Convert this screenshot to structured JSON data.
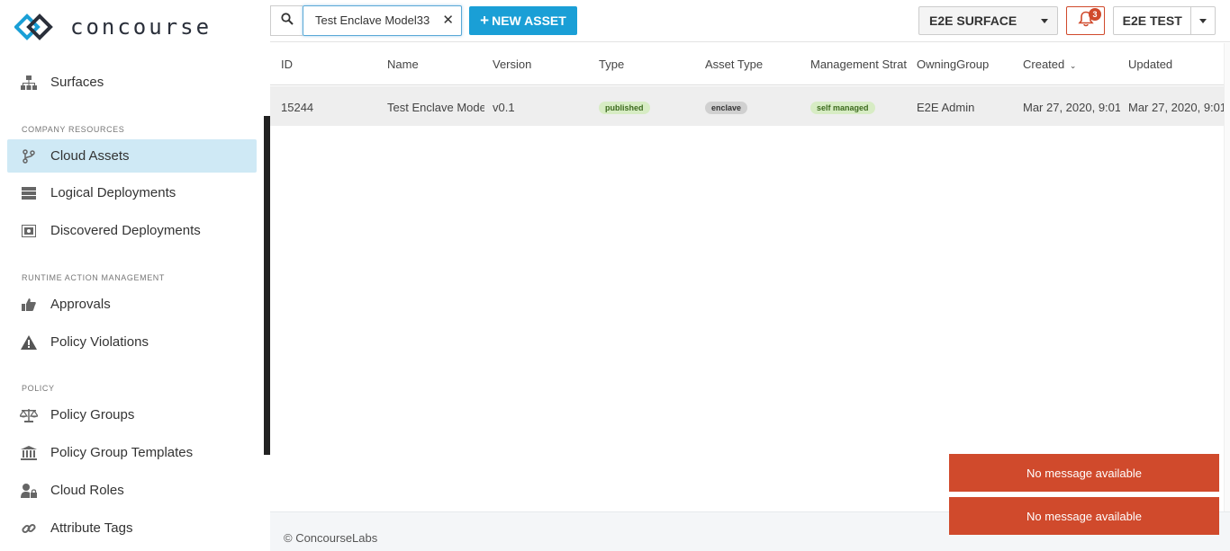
{
  "app": {
    "brand": "concourse"
  },
  "sidebar": {
    "surfaces": "Surfaces",
    "company_resources_label": "COMPANY RESOURCES",
    "cloud_assets": "Cloud Assets",
    "logical_deployments": "Logical Deployments",
    "discovered_deployments": "Discovered Deployments",
    "runtime_label": "RUNTIME ACTION MANAGEMENT",
    "approvals": "Approvals",
    "policy_violations": "Policy Violations",
    "policy_label": "POLICY",
    "policy_groups": "Policy Groups",
    "policy_group_templates": "Policy Group Templates",
    "cloud_roles": "Cloud Roles",
    "attribute_tags": "Attribute Tags"
  },
  "toolbar": {
    "search_value": "Test Enclave Model33",
    "new_asset_label": "NEW ASSET",
    "surface_selected": "E2E SURFACE",
    "notification_count": "3",
    "user_label": "E2E TEST"
  },
  "table": {
    "headers": [
      "ID",
      "Name",
      "Version",
      "Type",
      "Asset Type",
      "Management Strat",
      "OwningGroup",
      "Created",
      "Updated"
    ],
    "rows": [
      {
        "id": "15244",
        "name": "Test Enclave Mode",
        "version": "v0.1",
        "type": "published",
        "asset_type": "enclave",
        "management": "self managed",
        "owning_group": "E2E Admin",
        "created": "Mar 27, 2020, 9:01",
        "updated": "Mar 27, 2020, 9:01"
      }
    ]
  },
  "footer": {
    "copyright": "© ConcourseLabs"
  },
  "toasts": [
    "No message available",
    "No message available"
  ],
  "colors": {
    "accent": "#1a9fd6",
    "danger": "#d04a2c",
    "active_nav": "#cfe9f5",
    "pill_green": "#d7ecc4"
  }
}
